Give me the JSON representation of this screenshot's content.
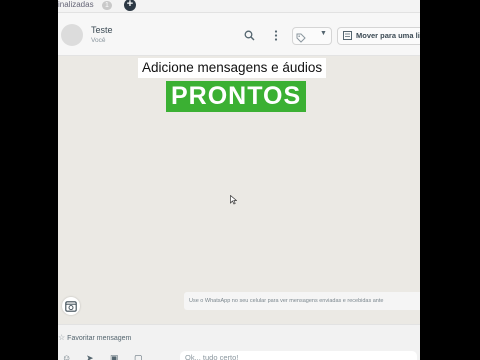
{
  "topbar": {
    "tab_label": "inalizadas",
    "badge_count": "1",
    "add_label": "+"
  },
  "header": {
    "contact_name": "Teste",
    "contact_subtitle": "Você",
    "move_button_label": "Mover para uma li"
  },
  "overlay": {
    "line1": "Adicione mensagens e áudios",
    "line2": "PRONTOS",
    "line1_bg": "#ffffff",
    "line2_bg": "#3bb033"
  },
  "chat": {
    "info_text": "Use o WhatsApp no seu celular para ver mensagens enviadas e recebidas ante"
  },
  "footer": {
    "favorite_label": "Favoritar mensagem",
    "input_placeholder": "Ok... tudo certo!"
  },
  "icons": [
    "search-icon",
    "more-vert-icon",
    "tag-icon",
    "chevron-down-icon",
    "move-icon",
    "schedule-icon",
    "star-icon",
    "emoji-icon",
    "attach-icon",
    "image-icon",
    "document-icon",
    "cursor-icon"
  ]
}
